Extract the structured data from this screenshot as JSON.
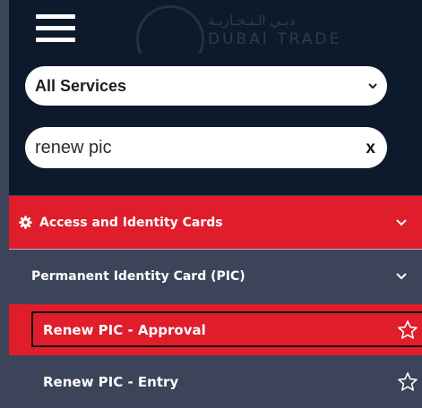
{
  "header": {
    "menu_icon": "hamburger-menu-icon",
    "logo_arabic": "دبـي الـتـجـاريـة",
    "logo_latin": "DUBAI TRADE"
  },
  "search": {
    "service_select_value": "All Services",
    "search_value": "renew pic",
    "clear_label": "x"
  },
  "menu": {
    "category": {
      "label": "Access and Identity Cards",
      "icon": "gear-icon"
    },
    "subcategory": {
      "label": "Permanent Identity Card (PIC)"
    },
    "services": [
      {
        "label": "Renew PIC - Approval",
        "highlighted": true
      },
      {
        "label": "Renew PIC - Entry",
        "highlighted": false
      }
    ]
  },
  "colors": {
    "header_bg": "#0d1a2c",
    "accent_red": "#e01d2b",
    "menu_bg": "#3b4458"
  }
}
